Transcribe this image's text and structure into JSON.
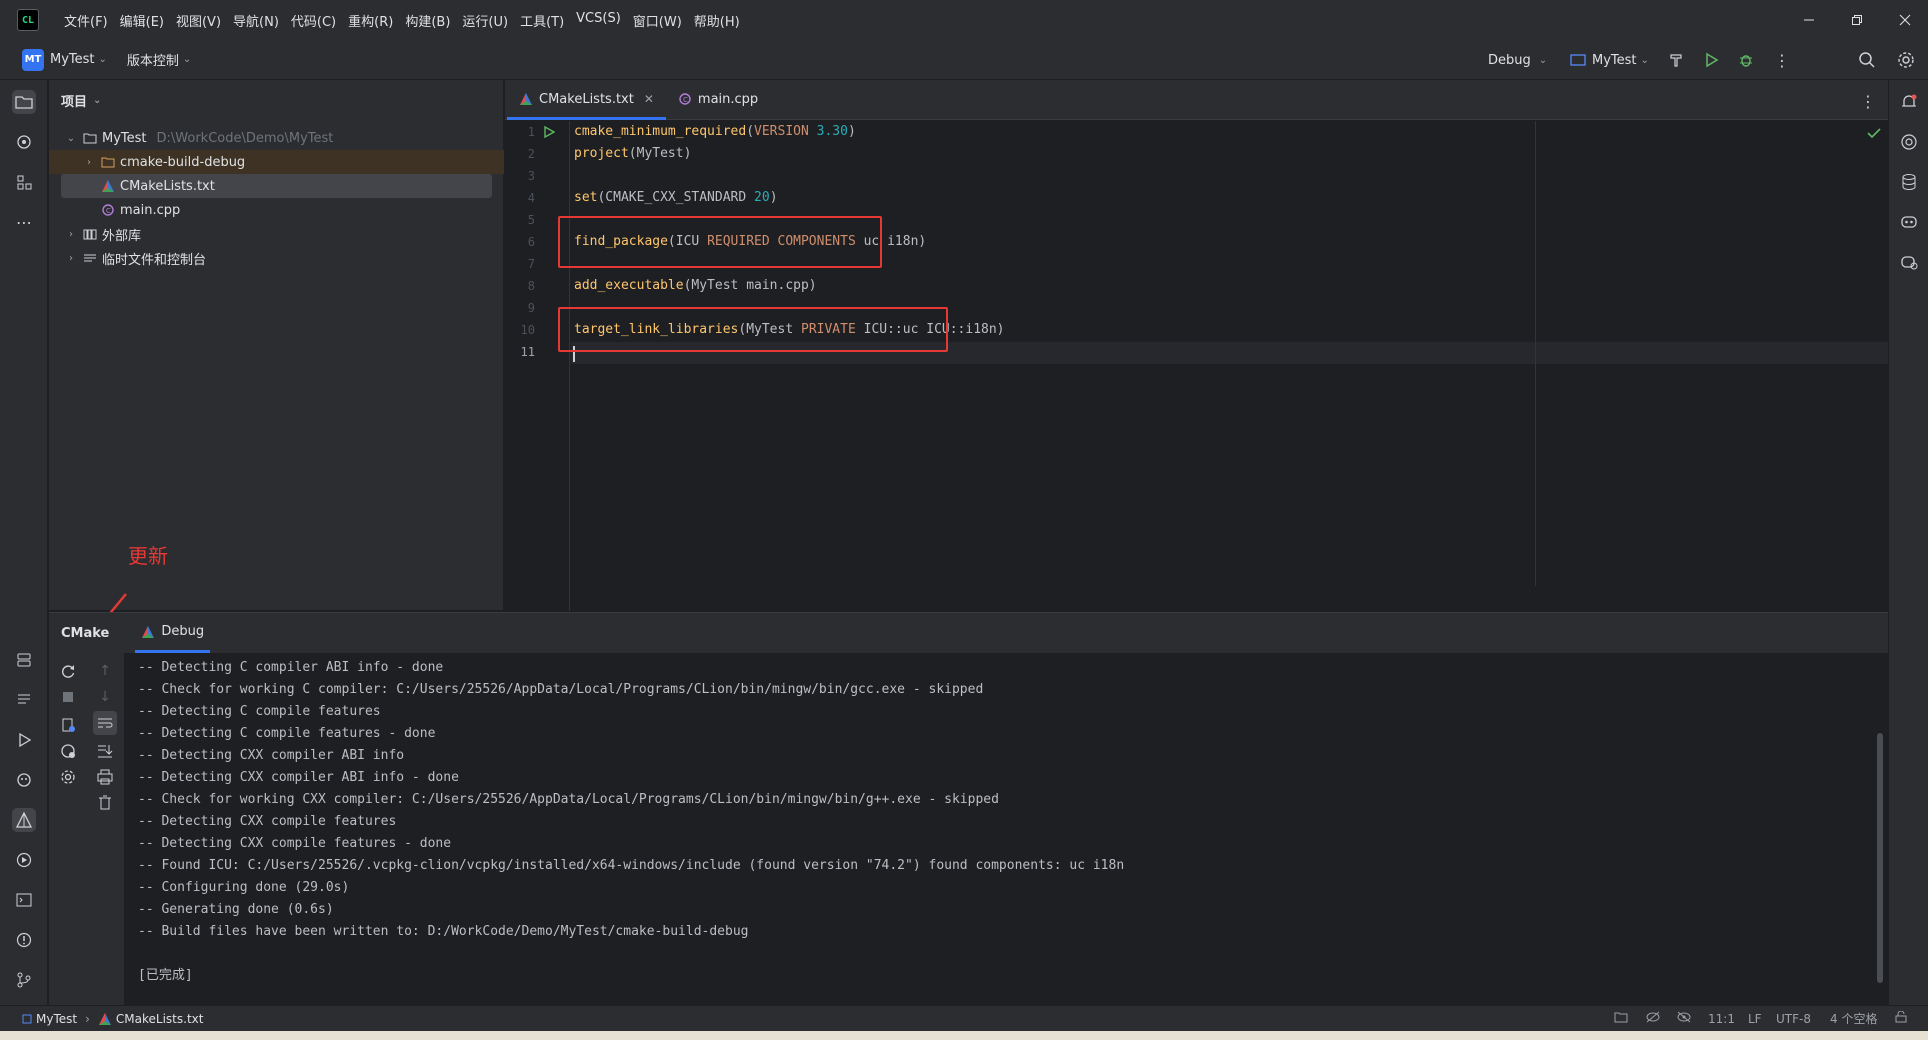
{
  "menu": [
    "文件(F)",
    "编辑(E)",
    "视图(V)",
    "导航(N)",
    "代码(C)",
    "重构(R)",
    "构建(B)",
    "运行(U)",
    "工具(T)",
    "VCS(S)",
    "窗口(W)",
    "帮助(H)"
  ],
  "toolbar": {
    "project_badge": "MT",
    "project_name": "MyTest",
    "vcs": "版本控制",
    "build_config": "Debug",
    "run_target": "MyTest"
  },
  "project_panel": {
    "title": "项目",
    "root_name": "MyTest",
    "root_path": "D:\\WorkCode\\Demo\\MyTest",
    "items": [
      {
        "label": "cmake-build-debug"
      },
      {
        "label": "CMakeLists.txt"
      },
      {
        "label": "main.cpp"
      },
      {
        "label": "外部库"
      },
      {
        "label": "临时文件和控制台"
      }
    ]
  },
  "editor": {
    "tabs": [
      {
        "label": "CMakeLists.txt"
      },
      {
        "label": "main.cpp"
      }
    ],
    "line_numbers": [
      "1",
      "2",
      "3",
      "4",
      "5",
      "6",
      "7",
      "8",
      "9",
      "10",
      "11"
    ]
  },
  "annotation": {
    "text": "更新"
  },
  "cmake": {
    "tabs": [
      {
        "label": "CMake"
      },
      {
        "label": "Debug"
      }
    ],
    "console": [
      "-- Detecting C compiler ABI info - done",
      "-- Check for working C compiler: C:/Users/25526/AppData/Local/Programs/CLion/bin/mingw/bin/gcc.exe - skipped",
      "-- Detecting C compile features",
      "-- Detecting C compile features - done",
      "-- Detecting CXX compiler ABI info",
      "-- Detecting CXX compiler ABI info - done",
      "-- Check for working CXX compiler: C:/Users/25526/AppData/Local/Programs/CLion/bin/mingw/bin/g++.exe - skipped",
      "-- Detecting CXX compile features",
      "-- Detecting CXX compile features - done",
      "-- Found ICU: C:/Users/25526/.vcpkg-clion/vcpkg/installed/x64-windows/include (found version \"74.2\") found components: uc i18n",
      "-- Configuring done (29.0s)",
      "-- Generating done (0.6s)",
      "-- Build files have been written to: D:/WorkCode/Demo/MyTest/cmake-build-debug",
      "",
      "[已完成]"
    ]
  },
  "statusbar": {
    "project": "MyTest",
    "file": "CMakeLists.txt",
    "position": "11:1",
    "line_ending": "LF",
    "encoding": "UTF-8",
    "indent": "4 个空格"
  }
}
